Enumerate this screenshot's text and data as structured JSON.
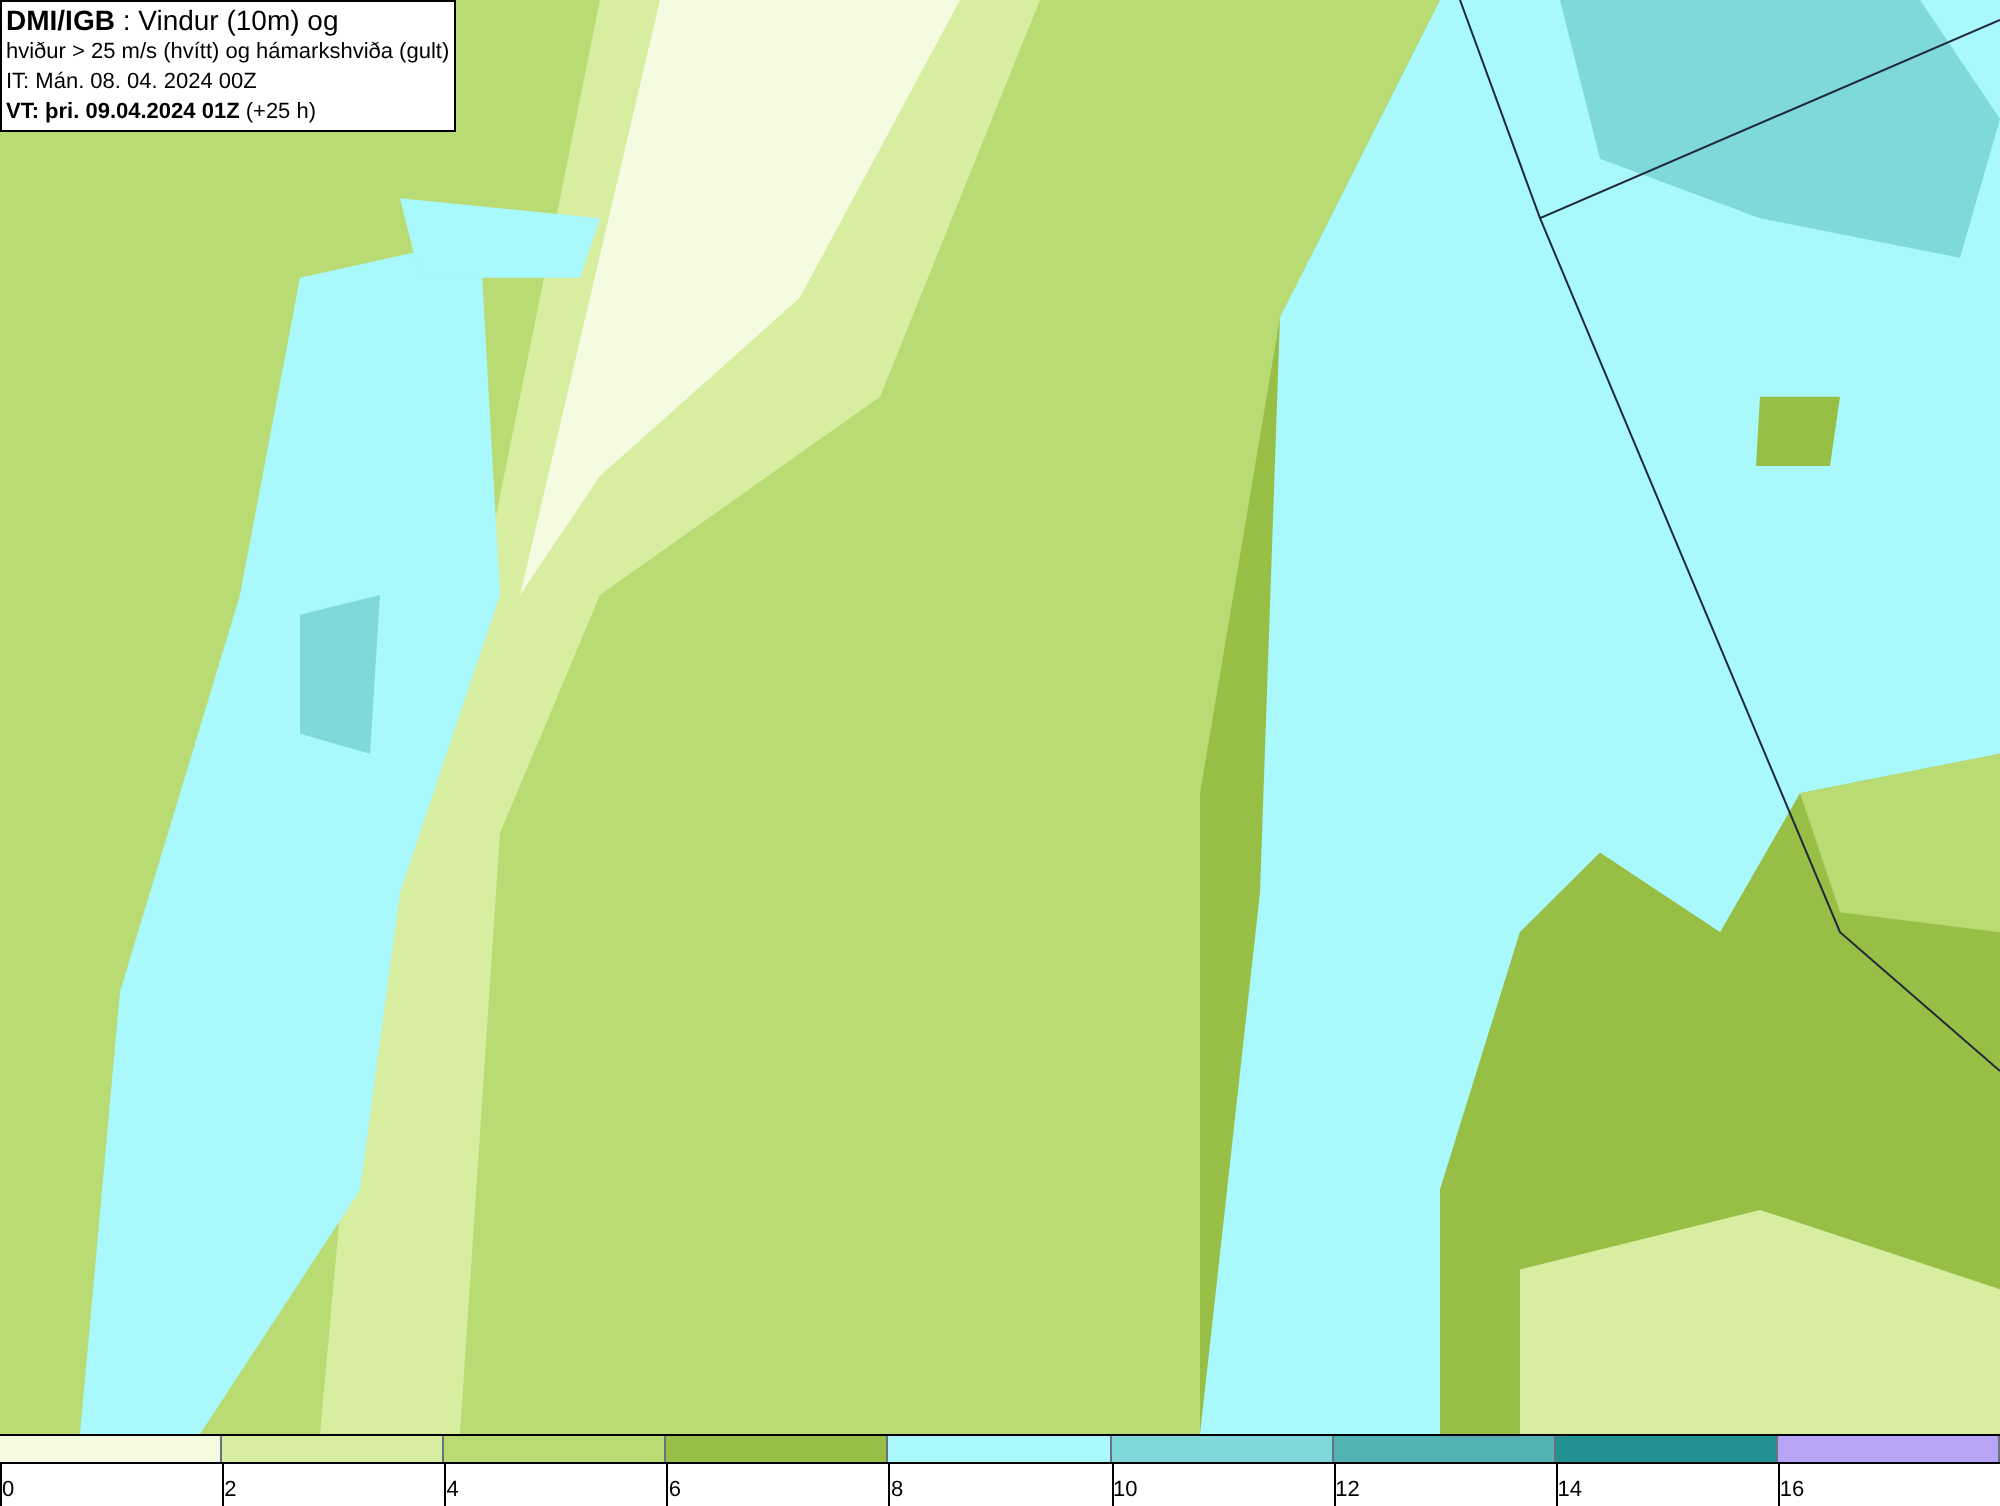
{
  "title_box": {
    "lines": [
      "**DMI/IGB** : Vindur (10m) og",
      "hviður > 25 m/s (hvítt) og hámarkshviða (gult)",
      "IT: Mán. 08. 04. 2024 00Z",
      "**VT: þri. 09.04.2024 01Z** (+25 h)"
    ]
  },
  "legend": {
    "segments": [
      {
        "label": "0",
        "color": "#f4fbe0"
      },
      {
        "label": "2",
        "color": "#d7eda0"
      },
      {
        "label": "4",
        "color": "#b9db73"
      },
      {
        "label": "6",
        "color": "#98bf45"
      },
      {
        "label": "8",
        "color": "#a9f8fb"
      },
      {
        "label": "10",
        "color": "#7fd8d9"
      },
      {
        "label": "12",
        "color": "#53b2b4"
      },
      {
        "label": "14",
        "color": "#219191"
      },
      {
        "label": "16",
        "color": "#b9a3f7"
      }
    ]
  }
}
